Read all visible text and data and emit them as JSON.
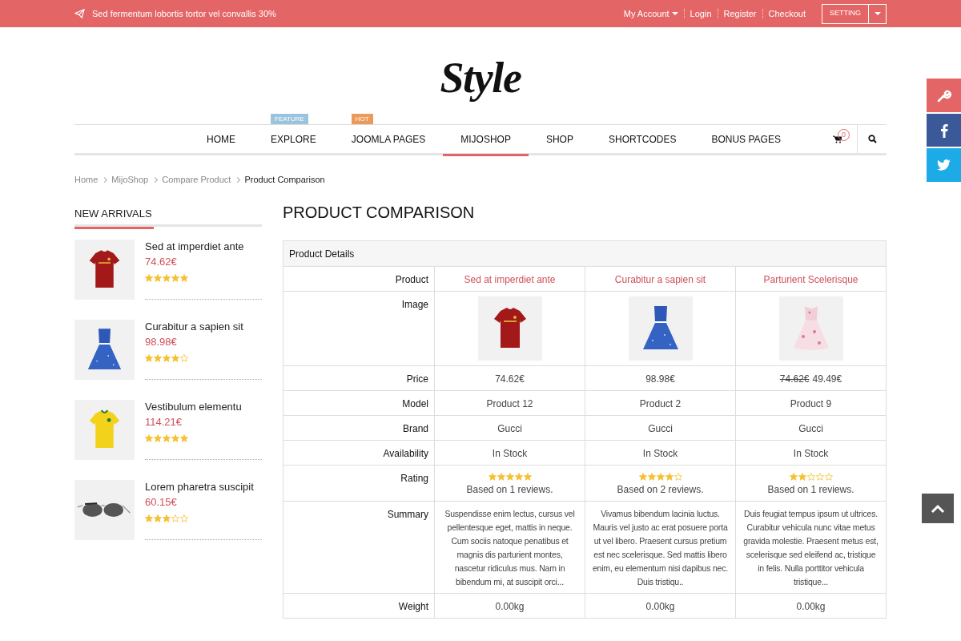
{
  "topbar": {
    "promo": "Sed fermentum lobortis tortor vel convallis 30%",
    "links": [
      "My Account",
      "Login",
      "Register",
      "Checkout"
    ],
    "setting": "SETTING"
  },
  "logo": "Style",
  "nav": [
    {
      "label": "HOME",
      "selected": false
    },
    {
      "label": "EXPLORE",
      "selected": false,
      "badge": "FEATURE",
      "color": "#9cc3dd"
    },
    {
      "label": "JOOMLA PAGES",
      "selected": false,
      "badge": "HOT",
      "color": "#ec9a5a"
    },
    {
      "label": "MIJOSHOP",
      "selected": true
    },
    {
      "label": "SHOP",
      "selected": false
    },
    {
      "label": "SHORTCODES",
      "selected": false
    },
    {
      "label": "BONUS PAGES",
      "selected": false
    }
  ],
  "cart_count": "0",
  "breadcrumb": [
    "Home",
    "MijoShop",
    "Compare Product",
    "Product Comparison"
  ],
  "sidebar": {
    "title": "NEW ARRIVALS",
    "items": [
      {
        "name": "Sed at imperdiet ante",
        "price": "74.62€",
        "stars": 5
      },
      {
        "name": "Curabitur a sapien sit",
        "price": "98.98€",
        "stars": 4
      },
      {
        "name": "Vestibulum elementu",
        "price": "114.21€",
        "stars": 5
      },
      {
        "name": "Lorem pharetra suscipit",
        "price": "60.15€",
        "stars": 3
      }
    ]
  },
  "page_title": "PRODUCT COMPARISON",
  "table": {
    "section": "Product Details",
    "labels": [
      "Product",
      "Image",
      "Price",
      "Model",
      "Brand",
      "Availability",
      "Rating",
      "Summary",
      "Weight"
    ],
    "products": [
      {
        "name": "Sed at imperdiet ante",
        "price": "74.62€",
        "model": "Product 12",
        "brand": "Gucci",
        "availability": "In Stock",
        "stars": 5,
        "reviews": "Based on 1 reviews.",
        "summary": "Suspendisse enim lectus, cursus vel pellentesque eget, mattis in neque. Cum sociis natoque penatibus et magnis dis parturient montes, nascetur ridiculus mus. Nam in bibendum mi, at suscipit orci...",
        "weight": "0.00kg"
      },
      {
        "name": "Curabitur a sapien sit",
        "price": "98.98€",
        "model": "Product 2",
        "brand": "Gucci",
        "availability": "In Stock",
        "stars": 4,
        "reviews": "Based on 2 reviews.",
        "summary": "Vivamus bibendum lacinia luctus. Mauris vel justo ac erat posuere porta ut vel libero. Praesent cursus pretium est nec scelerisque. Sed mattis libero enim, eu elementum nisi dapibus nec. Duis tristiqu..",
        "weight": "0.00kg"
      },
      {
        "name": "Parturient Scelerisque",
        "old_price": "74.62€",
        "price": "49.49€",
        "model": "Product 9",
        "brand": "Gucci",
        "availability": "In Stock",
        "stars": 2,
        "reviews": "Based on 1 reviews.",
        "summary": "Duis feugiat tempus ipsum ut ultrices. Curabitur vehicula nunc vitae metus gravida molestie. Praesent metus est, scelerisque sed eleifend ac, tristique in felis. Nulla porttitor vehicula tristique...",
        "weight": "0.00kg"
      }
    ]
  }
}
